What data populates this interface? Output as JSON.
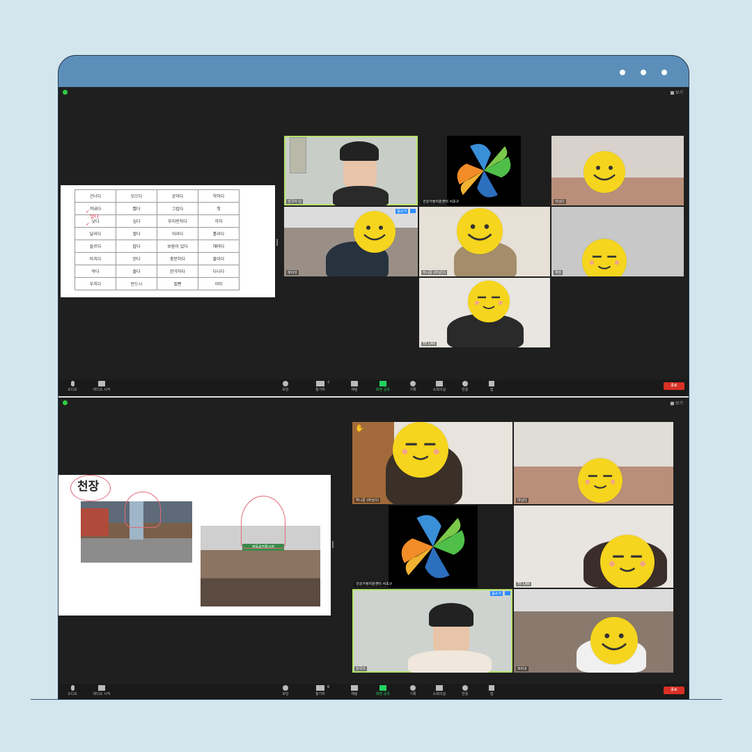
{
  "window": {
    "controls": [
      "dot-1",
      "dot-2",
      "dot-3"
    ]
  },
  "colors": {
    "titlebar": "#5b8fb9",
    "background": "#d3e6ee",
    "active_speaker": "#b6e36b",
    "end_button": "#d93025"
  },
  "top_session": {
    "view_label": "보기",
    "word_table": [
      [
        "건너다",
        "모으다",
        "강하다",
        "약하다"
      ],
      [
        "끼내다",
        "빨다",
        "그립다",
        "첫"
      ],
      [
        "낫다",
        "십다",
        "부지런하다",
        "각자"
      ],
      [
        "달리다",
        "쌓다",
        "어리다",
        "흘리다"
      ],
      [
        "들르다",
        "잡다",
        "보람이 있다",
        "해마다"
      ],
      [
        "마치다",
        "얻다",
        "충분하다",
        "줄이다"
      ],
      [
        "막다",
        "졸다",
        "한가하다",
        "다니다"
      ],
      [
        "부치다",
        "반드시",
        "될뻔",
        "이미"
      ]
    ],
    "annotation": "넣다",
    "tiles": [
      {
        "name": "한국어 님",
        "face": "none"
      },
      {
        "name": "건강가정지원센터 서초구",
        "face": "logo"
      },
      {
        "name": "마님다",
        "face": "smile"
      },
      {
        "name": "파비코",
        "face": "smile"
      },
      {
        "name": "허니문 (마님다)",
        "face": "smile"
      },
      {
        "name": "해정",
        "face": "calm"
      },
      {
        "name": "TE LAN",
        "face": "calm"
      }
    ],
    "tile_badges": {
      "speaker_badge": "음소거"
    },
    "toolbar": {
      "audio": "오디오",
      "video": "비디오 시작",
      "security": "보안",
      "participants": "참가자",
      "participants_count": "7",
      "chat": "채팅",
      "share": "화면 공유",
      "record": "기록",
      "breakout": "소회의실",
      "reactions": "반응",
      "apps": "앱",
      "end": "종료"
    }
  },
  "bottom_session": {
    "view_label": "보기",
    "slide_title": "천장",
    "market_sign": "영등포전통시장",
    "tiles": [
      {
        "name": "허니문 (마님다)",
        "face": "calm"
      },
      {
        "name": "마님다",
        "face": "calm"
      },
      {
        "name": "건강가정지원센터 서초구",
        "face": "logo"
      },
      {
        "name": "TE LAN",
        "face": "calm"
      },
      {
        "name": "한국어",
        "face": "none"
      },
      {
        "name": "파비코",
        "face": "smile"
      }
    ],
    "tile_badges": {
      "speaker_badge": "음소거"
    },
    "toolbar": {
      "audio": "오디오",
      "video": "비디오 시작",
      "security": "보안",
      "participants": "참가자",
      "participants_count": "6",
      "chat": "채팅",
      "share": "화면 공유",
      "record": "기록",
      "breakout": "소회의실",
      "reactions": "반응",
      "apps": "앱",
      "end": "종료"
    }
  }
}
